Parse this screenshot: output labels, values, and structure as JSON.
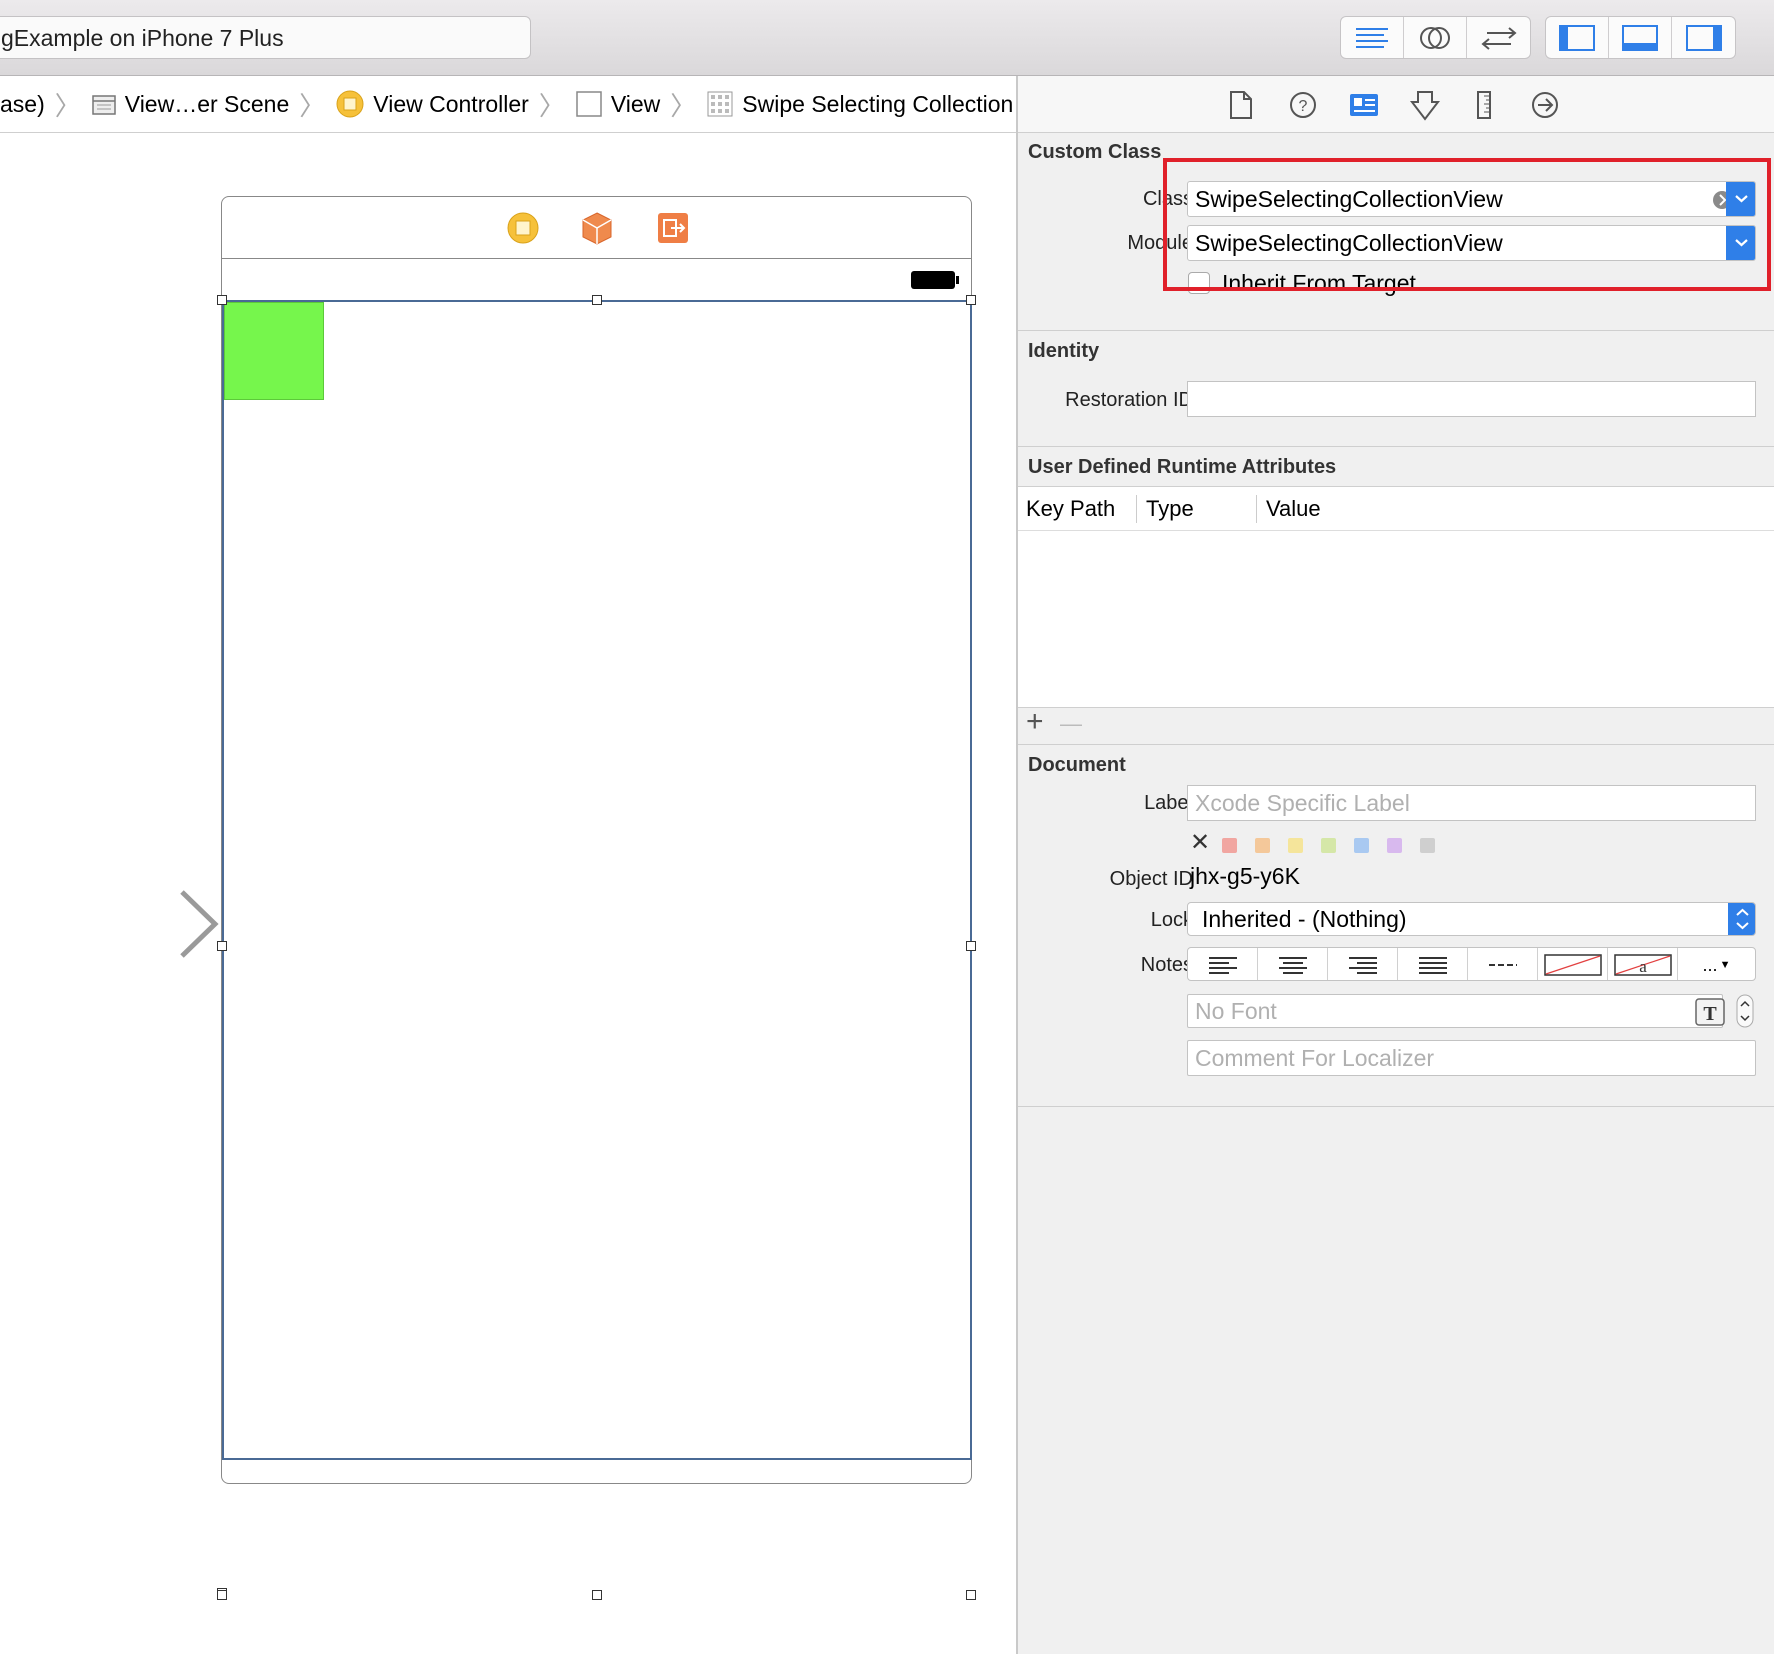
{
  "toolbar": {
    "scheme_title": "gExample on iPhone 7 Plus",
    "editor_buttons": [
      "standard-editor",
      "assistant-editor",
      "version-editor"
    ],
    "view_buttons": [
      "navigator-toggle",
      "debug-area-toggle",
      "utilities-toggle"
    ]
  },
  "breadcrumb": {
    "items": [
      {
        "label": "ase)",
        "icon": "none"
      },
      {
        "label": "View…er Scene",
        "icon": "scene-icon"
      },
      {
        "label": "View Controller",
        "icon": "view-controller-icon"
      },
      {
        "label": "View",
        "icon": "view-icon"
      },
      {
        "label": "Swipe Selecting Collection View",
        "icon": "collection-view-icon"
      }
    ]
  },
  "inspector_tabs": [
    "file-inspector",
    "quick-help",
    "identity-inspector",
    "attributes-inspector",
    "size-inspector",
    "connections-inspector"
  ],
  "custom_class": {
    "title": "Custom Class",
    "class_label": "Class",
    "class_value": "SwipeSelectingCollectionView",
    "module_label": "Module",
    "module_value": "SwipeSelectingCollectionView",
    "inherit_label": "Inherit From Target",
    "inherit_checked": false,
    "highlight_color": "#e0202a"
  },
  "identity": {
    "title": "Identity",
    "restoration_label": "Restoration ID",
    "restoration_value": ""
  },
  "runtime_attrs": {
    "title": "User Defined Runtime Attributes",
    "columns": [
      "Key Path",
      "Type",
      "Value"
    ],
    "add": "+",
    "remove": "—"
  },
  "document": {
    "title": "Document",
    "label_label": "Label",
    "label_placeholder": "Xcode Specific Label",
    "clear_symbol": "✕",
    "label_colors": [
      "#f1a6a1",
      "#f4c89a",
      "#f5e59b",
      "#d5e7a8",
      "#a9c9f1",
      "#d8b9ee",
      "#cfcfcf"
    ],
    "object_id_label": "Object ID",
    "object_id_value": "jhx-g5-y6K",
    "lock_label": "Lock",
    "lock_value": "Inherited - (Nothing)",
    "notes_label": "Notes",
    "notes_more": "...",
    "font_placeholder": "No Font",
    "comment_placeholder": "Comment For Localizer"
  },
  "canvas": {
    "cell_color": "#76f64c",
    "accent_blue": "#2f7fe8"
  }
}
